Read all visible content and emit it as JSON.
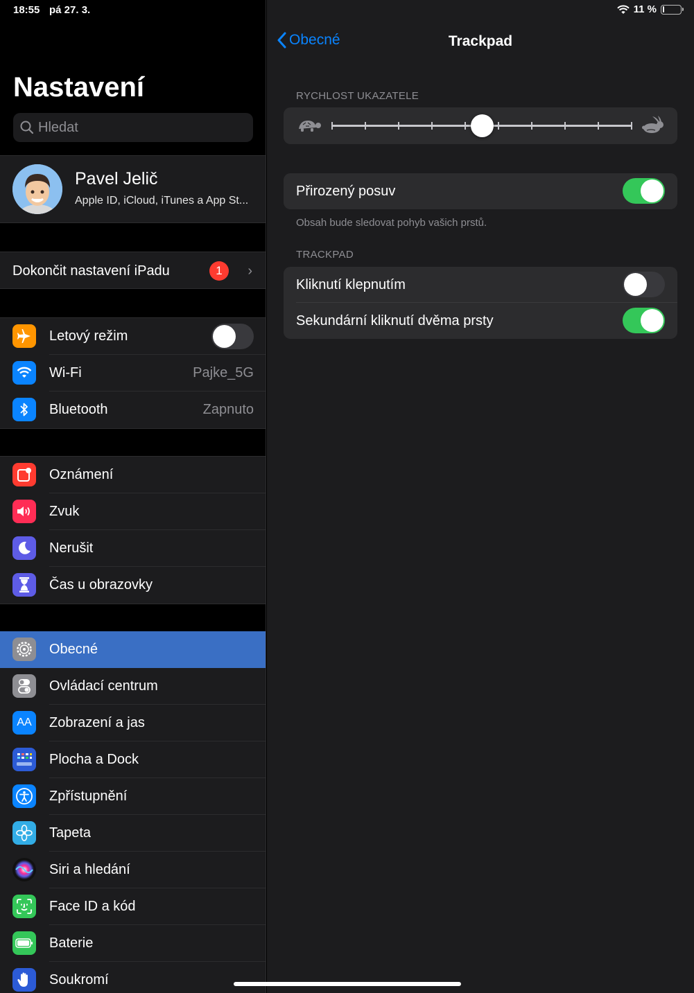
{
  "status": {
    "time": "18:55",
    "date": "pá 27. 3.",
    "battery": "11 %",
    "battery_level": 0.11
  },
  "sidebar": {
    "title": "Nastavení",
    "search_placeholder": "Hledat",
    "profile": {
      "name": "Pavel Jelič",
      "subtitle": "Apple ID, iCloud, iTunes a App St..."
    },
    "finish_setup": {
      "label": "Dokončit nastavení iPadu",
      "badge": "1"
    },
    "connectivity": [
      {
        "label": "Letový režim",
        "icon": "airplane-icon",
        "color": "#ff9500",
        "toggle": false
      },
      {
        "label": "Wi-Fi",
        "icon": "wifi-icon",
        "color": "#0a84ff",
        "value": "Pajke_5G"
      },
      {
        "label": "Bluetooth",
        "icon": "bluetooth-icon",
        "color": "#0a84ff",
        "value": "Zapnuto"
      }
    ],
    "notifications": [
      {
        "label": "Oznámení",
        "icon": "notifications-icon",
        "color": "#ff3b30"
      },
      {
        "label": "Zvuk",
        "icon": "sound-icon",
        "color": "#ff2d55"
      },
      {
        "label": "Nerušit",
        "icon": "moon-icon",
        "color": "#5e5ce6"
      },
      {
        "label": "Čas u obrazovky",
        "icon": "hourglass-icon",
        "color": "#5e5ce6"
      }
    ],
    "general": [
      {
        "label": "Obecné",
        "icon": "gear-icon",
        "color": "#8e8e93",
        "selected": true
      },
      {
        "label": "Ovládací centrum",
        "icon": "switches-icon",
        "color": "#8e8e93"
      },
      {
        "label": "Zobrazení a jas",
        "icon": "text-size-icon",
        "color": "#0a84ff"
      },
      {
        "label": "Plocha a Dock",
        "icon": "grid-icon",
        "color": "#2c5bd6"
      },
      {
        "label": "Zpřístupnění",
        "icon": "accessibility-icon",
        "color": "#0a84ff"
      },
      {
        "label": "Tapeta",
        "icon": "flower-icon",
        "color": "#32ade6"
      },
      {
        "label": "Siri a hledání",
        "icon": "siri-icon",
        "color": "#222"
      },
      {
        "label": "Face ID a kód",
        "icon": "faceid-icon",
        "color": "#34c759"
      },
      {
        "label": "Baterie",
        "icon": "battery-icon",
        "color": "#34c759"
      },
      {
        "label": "Soukromí",
        "icon": "hand-icon",
        "color": "#2c5bd6"
      }
    ]
  },
  "detail": {
    "back_label": "Obecné",
    "title": "Trackpad",
    "speed_header": "RYCHLOST UKAZATELE",
    "speed_value": 0.5,
    "speed_ticks": 10,
    "natural_scroll": {
      "label": "Přirozený posuv",
      "on": true
    },
    "natural_note": "Obsah bude sledovat pohyb vašich prstů.",
    "trackpad_header": "TRACKPAD",
    "tap_click": {
      "label": "Kliknutí klepnutím",
      "on": false
    },
    "secondary_click": {
      "label": "Sekundární kliknutí dvěma prsty",
      "on": true
    }
  }
}
